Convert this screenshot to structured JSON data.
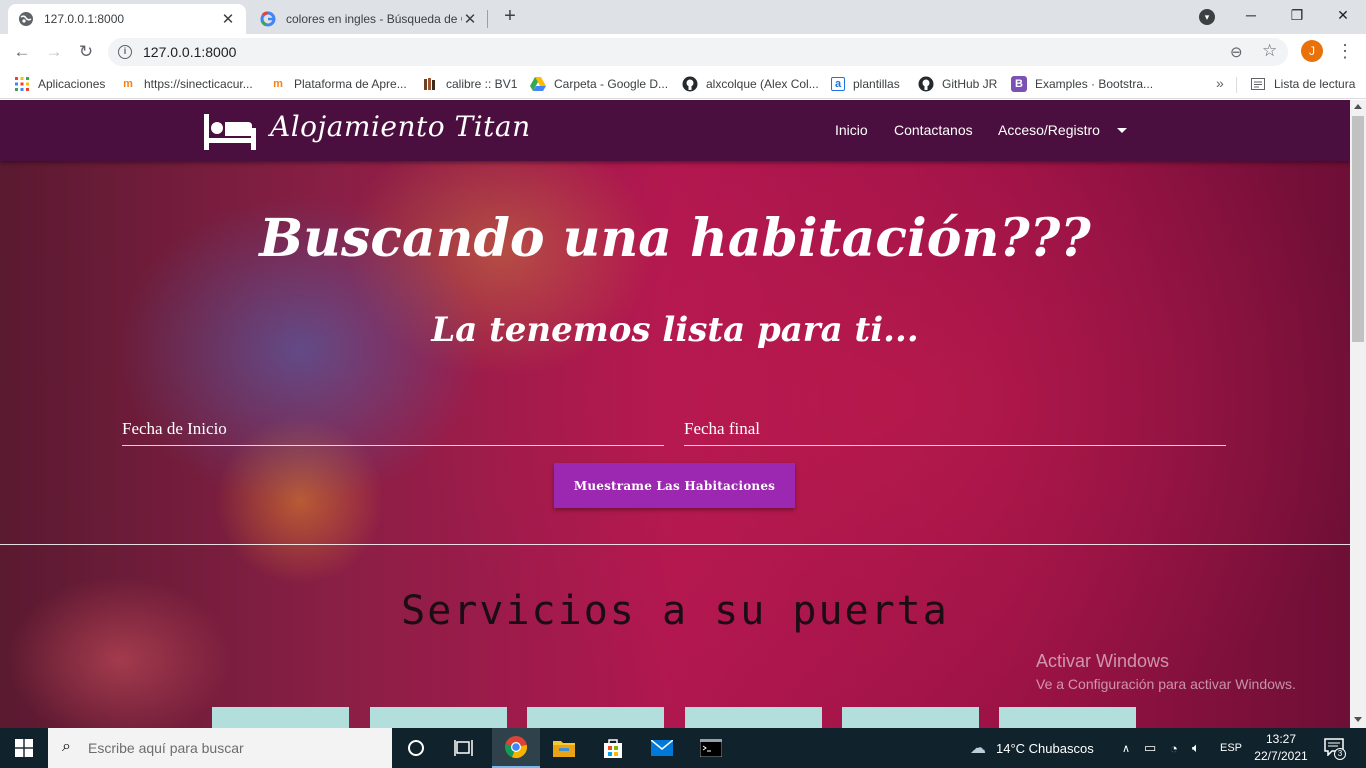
{
  "browser": {
    "tabs": [
      {
        "title": "127.0.0.1:8000",
        "favicon": "globe-icon",
        "active": true
      },
      {
        "title": "colores en ingles - Búsqueda de Google",
        "favicon": "google-icon",
        "active": false
      }
    ],
    "url": "127.0.0.1:8000",
    "profile_initial": "J",
    "profile_color": "#e8710a",
    "bookmarks": [
      {
        "label": "Aplicaciones",
        "icon": "apps-grid-icon"
      },
      {
        "label": "https://sinecticacur...",
        "icon": "moodle-icon"
      },
      {
        "label": "Plataforma de Apre...",
        "icon": "moodle-icon"
      },
      {
        "label": "calibre :: BV1",
        "icon": "calibre-icon"
      },
      {
        "label": "Carpeta - Google D...",
        "icon": "google-drive-icon"
      },
      {
        "label": "alxcolque (Alex Col...",
        "icon": "github-icon"
      },
      {
        "label": "plantillas",
        "icon": "plantillas-icon"
      },
      {
        "label": "GitHub JR",
        "icon": "github-icon"
      },
      {
        "label": "Examples · Bootstra...",
        "icon": "bootstrap-icon"
      }
    ],
    "reading_list": "Lista de lectura"
  },
  "site": {
    "brand": "Alojamiento Titan",
    "nav": [
      "Inicio",
      "Contactanos",
      "Acceso/Registro"
    ],
    "hero_title": "Buscando una habitación???",
    "hero_subtitle": "La tenemos lista para ti...",
    "start_date_placeholder": "Fecha de Inicio",
    "end_date_placeholder": "Fecha final",
    "cta_label": "Muestrame Las Habitaciones",
    "services_title": "Servicios a su puerta",
    "accent": "#9c27b0",
    "navbar_color": "#4a0f3e",
    "card_color": "#b2dfdb"
  },
  "watermark": {
    "line1": "Activar Windows",
    "line2": "Ve a Configuración para activar Windows."
  },
  "taskbar": {
    "search_placeholder": "Escribe aquí para buscar",
    "weather": "14°C  Chubascos",
    "language": "ESP",
    "time": "13:27",
    "date": "22/7/2021",
    "notifications": "3"
  }
}
